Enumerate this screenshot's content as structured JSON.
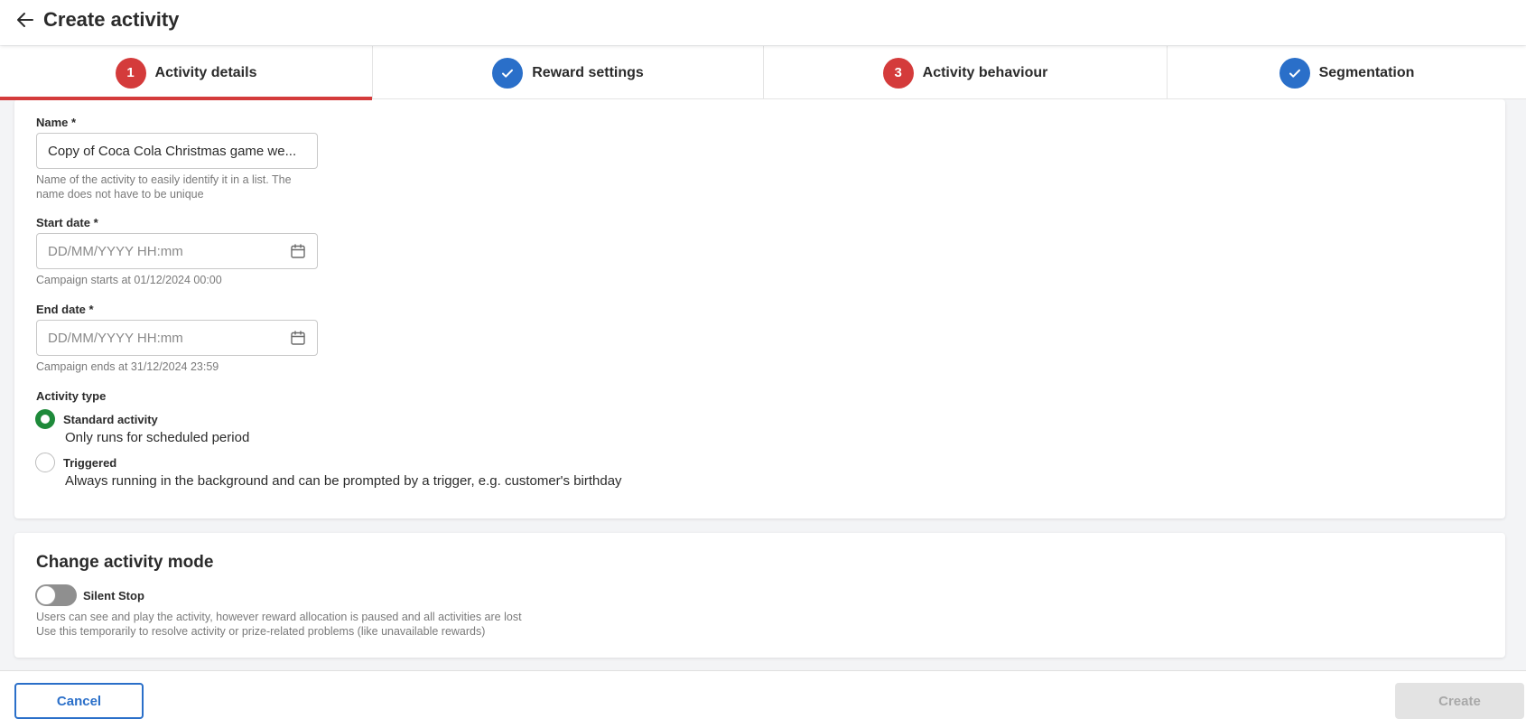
{
  "header": {
    "title": "Create activity"
  },
  "stepper": {
    "steps": [
      {
        "badge": "1",
        "label": "Activity details"
      },
      {
        "badge": "",
        "label": "Reward settings"
      },
      {
        "badge": "3",
        "label": "Activity behaviour"
      },
      {
        "badge": "",
        "label": "Segmentation"
      }
    ]
  },
  "form": {
    "name": {
      "label": "Name *",
      "value": "Copy of Coca Cola Christmas game we...",
      "hint_line1": "Name of the activity to easily identify it in a list. The",
      "hint_line2": "name does not have to be unique"
    },
    "start_date": {
      "label": "Start date *",
      "placeholder": "DD/MM/YYYY HH:mm",
      "hint": "Campaign starts at 01/12/2024 00:00"
    },
    "end_date": {
      "label": "End date *",
      "placeholder": "DD/MM/YYYY HH:mm",
      "hint": "Campaign ends at 31/12/2024 23:59"
    },
    "activity_type": {
      "label": "Activity type",
      "options": [
        {
          "title": "Standard activity",
          "description": "Only runs for scheduled period",
          "selected": true
        },
        {
          "title": "Triggered",
          "description": "Always running in the background and can be prompted by a trigger, e.g. customer's birthday",
          "selected": false
        }
      ]
    }
  },
  "mode": {
    "title": "Change activity mode",
    "toggle_label": "Silent Stop",
    "toggle_on": false,
    "hint_line1": "Users can see and play the activity, however reward allocation is paused and all activities are lost",
    "hint_line2": "Use this temporarily to resolve activity or prize-related problems (like unavailable rewards)"
  },
  "footer": {
    "cancel_label": "Cancel",
    "create_label": "Create"
  },
  "colors": {
    "accent_red": "#d43b3b",
    "accent_blue": "#2a6fc9",
    "radio_green": "#1e8a3a"
  }
}
